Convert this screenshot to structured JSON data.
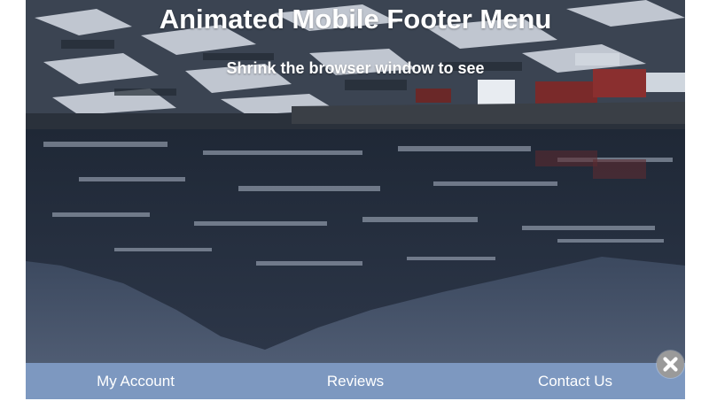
{
  "header": {
    "title": "Animated Mobile Footer Menu",
    "subtitle": "Shrink the browser window to see"
  },
  "background": {
    "icon": "lake-mountain-village-photo"
  },
  "footer": {
    "background_color": "#7d98c0",
    "items": [
      {
        "label": "My Account"
      },
      {
        "label": "Reviews"
      },
      {
        "label": "Contact Us"
      }
    ]
  },
  "close_button": {
    "icon": "close-icon",
    "color": "#9a9a9a"
  }
}
